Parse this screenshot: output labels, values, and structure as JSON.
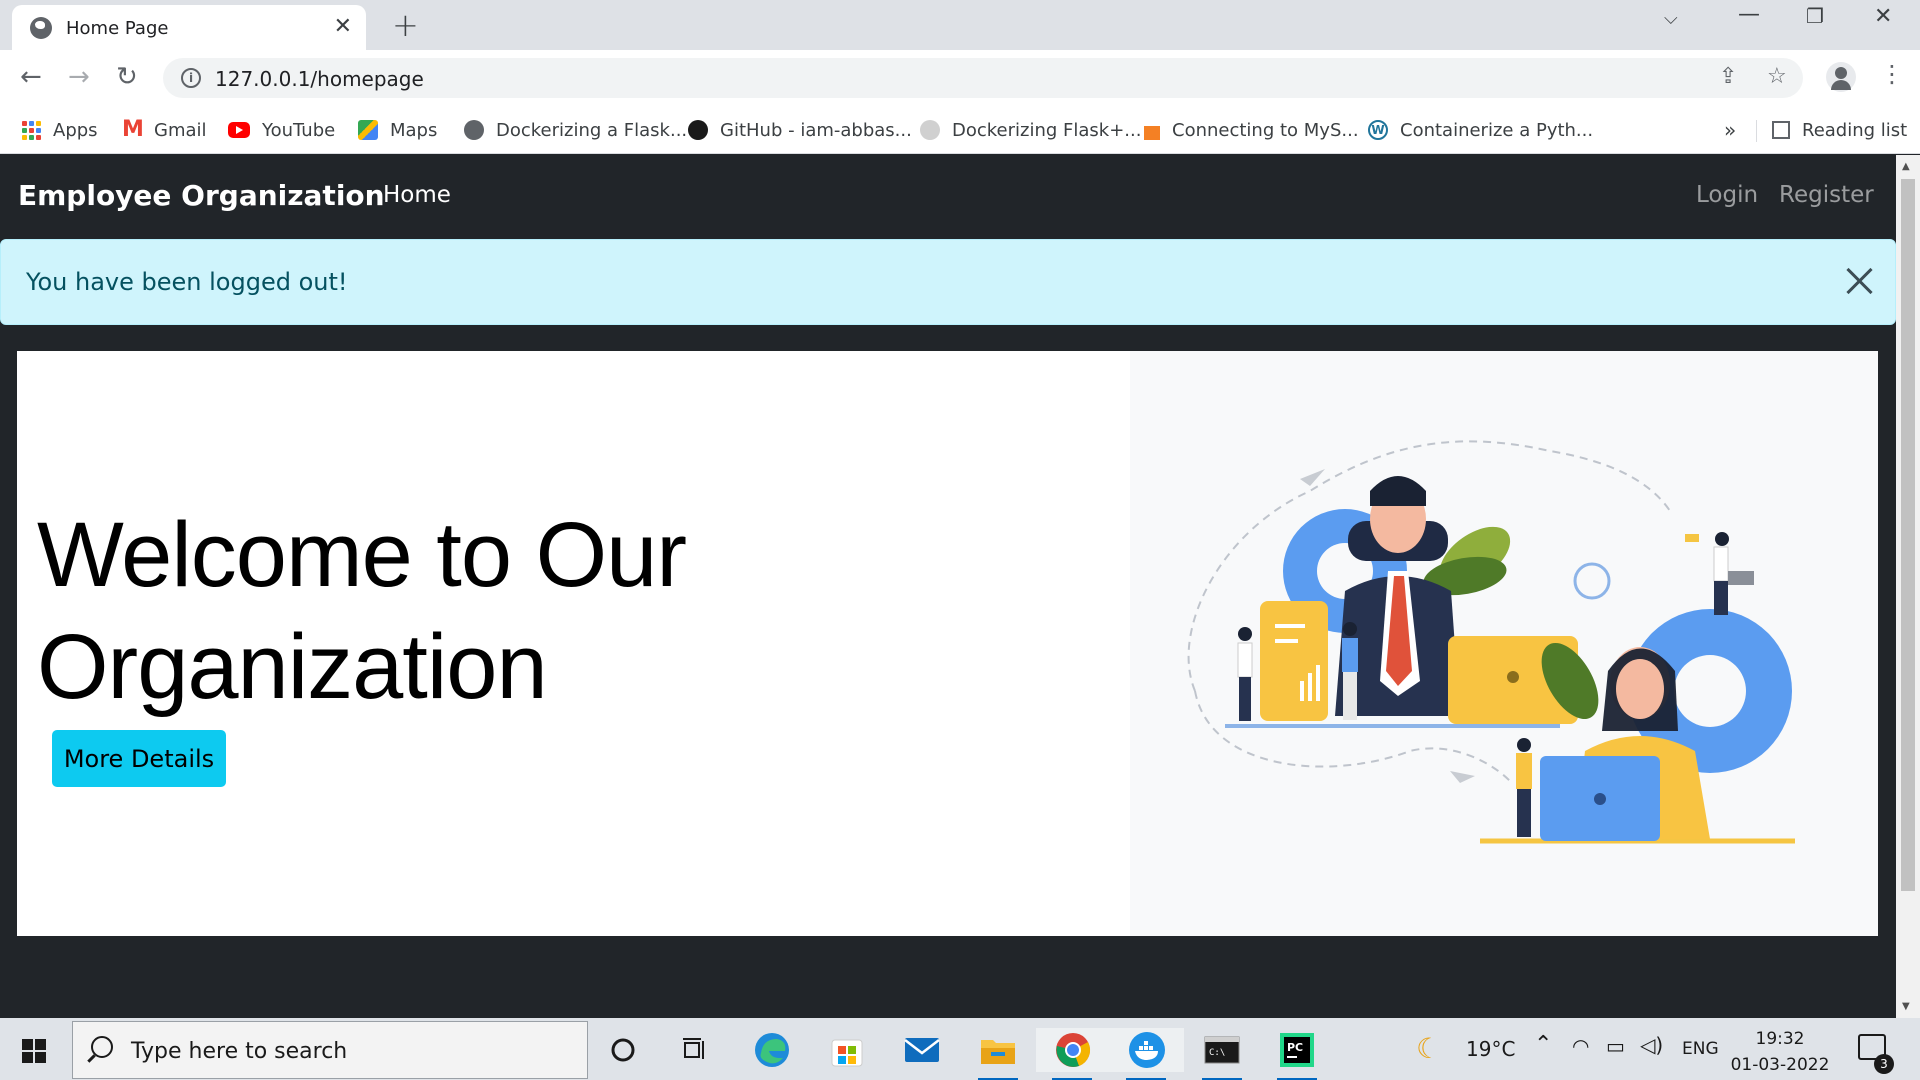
{
  "browser": {
    "tab_title": "Home Page",
    "url": "127.0.0.1/homepage",
    "bookmarks": [
      {
        "label": "Apps",
        "icon": "apps-grid-icon"
      },
      {
        "label": "Gmail",
        "icon": "gmail-icon"
      },
      {
        "label": "YouTube",
        "icon": "youtube-icon"
      },
      {
        "label": "Maps",
        "icon": "maps-icon"
      },
      {
        "label": "Dockerizing a Flask...",
        "icon": "globe-icon"
      },
      {
        "label": "GitHub - iam-abbas...",
        "icon": "github-icon"
      },
      {
        "label": "Dockerizing Flask+...",
        "icon": "site-icon"
      },
      {
        "label": "Connecting to MyS...",
        "icon": "stackoverflow-icon"
      },
      {
        "label": "Containerize a Pyth...",
        "icon": "wordpress-icon"
      }
    ],
    "bookmarks_more": "»",
    "reading_list": "Reading list"
  },
  "site": {
    "brand": "Employee Organization",
    "nav": {
      "home": "Home",
      "login": "Login",
      "register": "Register"
    },
    "alert": "You have been logged out!",
    "hero": {
      "title_line1": "Welcome to Our",
      "title_line2": "Organization",
      "button": "More Details"
    }
  },
  "taskbar": {
    "search_placeholder": "Type here to search",
    "weather": "19°C",
    "language": "ENG",
    "time": "19:32",
    "date": "01-03-2022",
    "notification_count": "3"
  },
  "colors": {
    "navbar_bg": "#212529",
    "alert_bg": "#cff4fc",
    "alert_text": "#055160",
    "button_bg": "#0dcaf0"
  }
}
